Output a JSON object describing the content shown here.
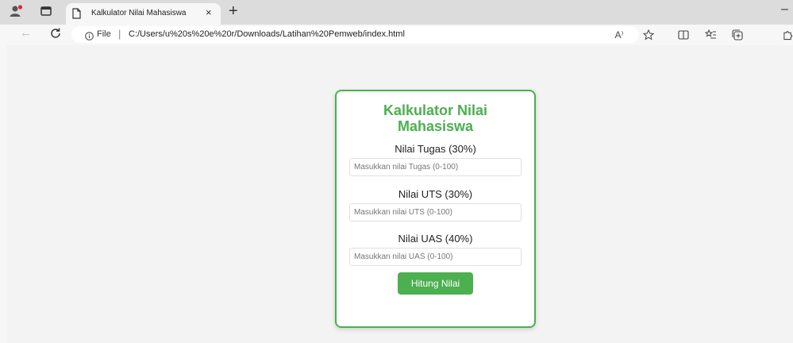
{
  "browser": {
    "tab": {
      "title": "Kalkulator Nilai Mahasiswa",
      "close_glyph": "×"
    },
    "new_tab_glyph": "+",
    "minimize_glyph": "–",
    "address": {
      "scheme_label": "File",
      "separator": "|",
      "url": "C:/Users/u%20s%20e%20r/Downloads/Latihan%20Pemweb/index.html"
    },
    "read_aloud_label": "A⁾"
  },
  "card": {
    "title_line1": "Kalkulator Nilai",
    "title_line2": "Mahasiswa",
    "fields": [
      {
        "label": "Nilai Tugas (30%)",
        "placeholder": "Masukkan nilai Tugas (0-100)",
        "value": ""
      },
      {
        "label": "Nilai UTS (30%)",
        "placeholder": "Masukkan nilai UTS (0-100)",
        "value": ""
      },
      {
        "label": "Nilai UAS (40%)",
        "placeholder": "Masukkan nilai UAS (0-100)",
        "value": ""
      }
    ],
    "button_label": "Hitung Nilai"
  },
  "colors": {
    "accent": "#4caf50",
    "tabstrip_bg": "#dcdcdc",
    "page_bg": "#f3f3f3"
  }
}
